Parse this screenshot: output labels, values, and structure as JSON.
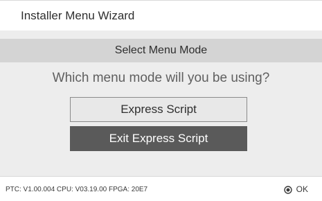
{
  "window": {
    "title": "Installer Menu Wizard"
  },
  "mode_bar": {
    "label": "Select Menu Mode"
  },
  "prompt": {
    "question": "Which menu mode will you be using?"
  },
  "options": {
    "express_label": "Express Script",
    "exit_label": "Exit Express Script"
  },
  "status": {
    "version_text": "PTC:  V1.00.004 CPU: V03.19.00 FPGA: 20E7",
    "ok_label": "OK",
    "ok_icon": "ok-circle-icon"
  },
  "colors": {
    "background": "#ffffff",
    "panel": "#ededed",
    "mode_bar": "#d4d4d4",
    "selected_button": "#5a5a5a",
    "unselected_button": "#e8e8e8"
  }
}
